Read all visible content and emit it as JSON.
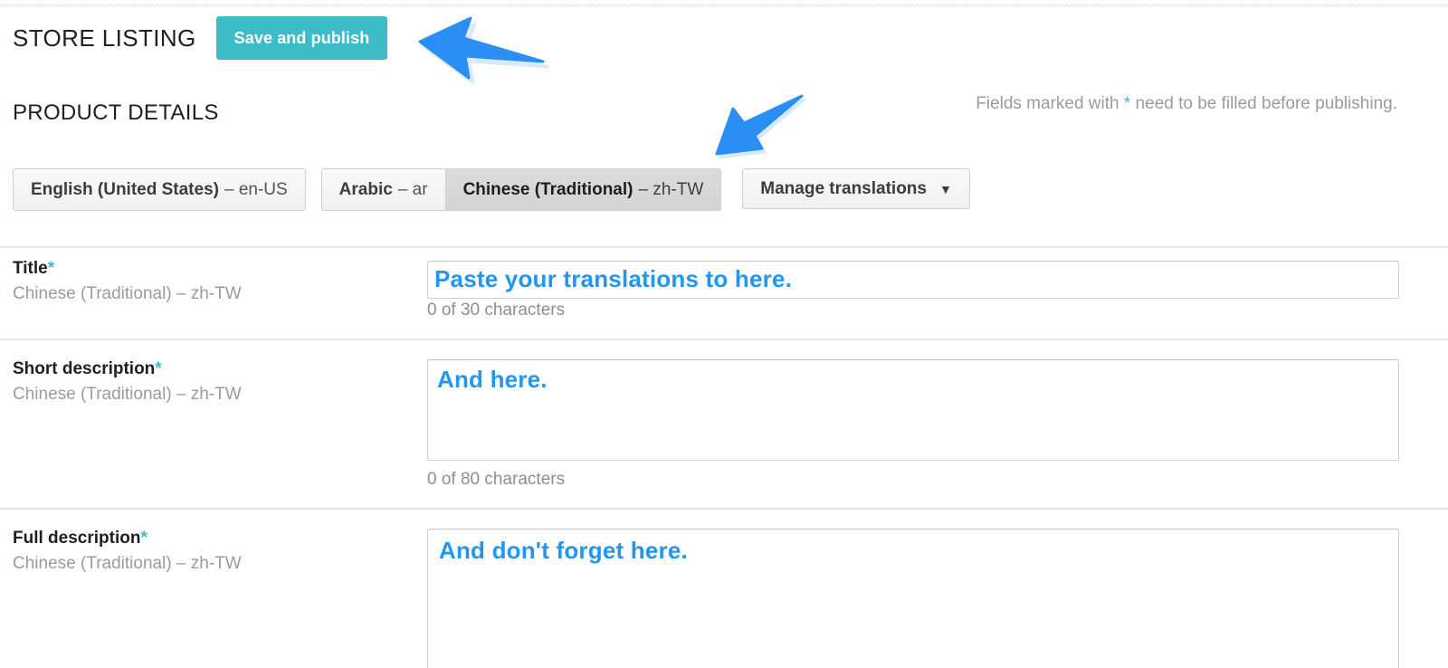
{
  "header": {
    "page_title": "STORE LISTING",
    "save_label": "Save and publish"
  },
  "section": {
    "title": "PRODUCT DETAILS",
    "required_note_before": "Fields marked with ",
    "required_note_star": "*",
    "required_note_after": " need to be filled before publishing."
  },
  "language_tabs": [
    {
      "name": "English (United States)",
      "code": "– en-US",
      "active": false
    },
    {
      "name": "Arabic",
      "code": "– ar",
      "active": false
    },
    {
      "name": "Chinese (Traditional)",
      "code": "– zh-TW",
      "active": true
    }
  ],
  "manage_translations": {
    "label": "Manage translations",
    "caret": "▼"
  },
  "fields": [
    {
      "label": "Title",
      "required_star": "*",
      "sub": "Chinese (Traditional) – zh-TW",
      "value": "",
      "counter": "0 of 30 characters"
    },
    {
      "label": "Short description",
      "required_star": "*",
      "sub": "Chinese (Traditional) – zh-TW",
      "value": "",
      "counter": "0 of 80 characters"
    },
    {
      "label": "Full description",
      "required_star": "*",
      "sub": "Chinese (Traditional) – zh-TW",
      "value": "",
      "counter": ""
    }
  ],
  "annotations": {
    "callout_title": "Paste your translations to here.",
    "callout_short": "And here.",
    "callout_full": "And don't forget here.",
    "arrow_color": "#2b8ef5"
  },
  "colors": {
    "accent_teal": "#3dbcc8",
    "annotation_blue": "#2196f3",
    "text_dark": "#1f1f1f",
    "text_muted": "#9b9b9b",
    "border": "#cfcfcf"
  }
}
